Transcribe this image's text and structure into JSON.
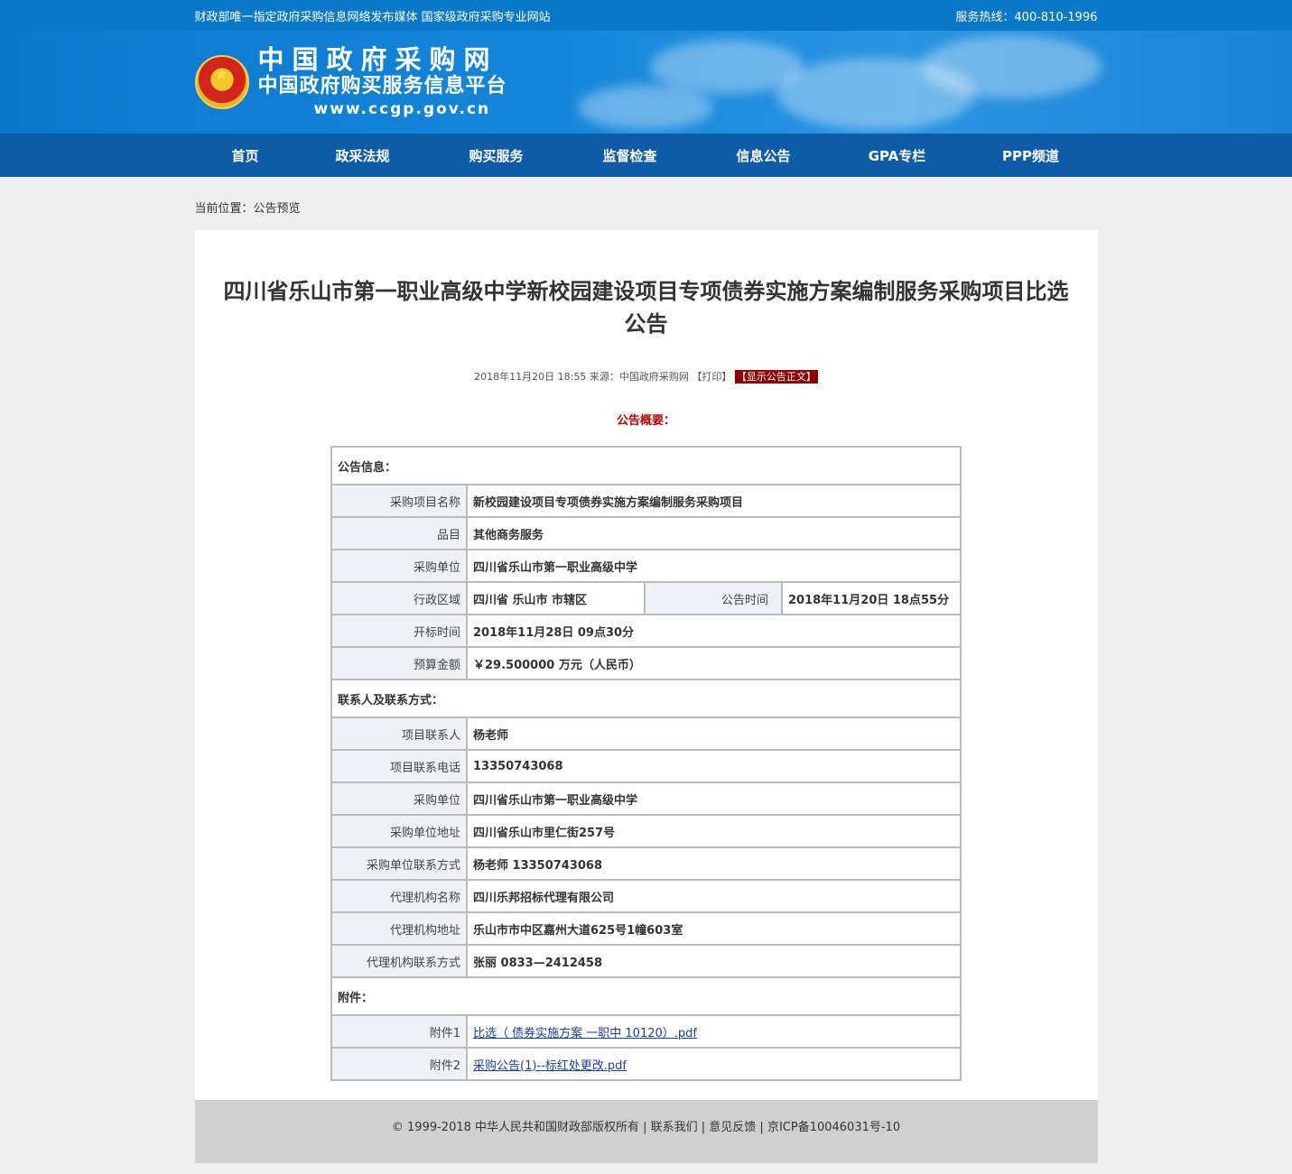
{
  "topbar": {
    "left": "财政部唯一指定政府采购信息网络发布媒体  国家级政府采购专业网站",
    "right": "服务热线：400-810-1996"
  },
  "logo": {
    "line1": "中国政府采购网",
    "line2": "中国政府购买服务信息平台",
    "line3": "www.ccgp.gov.cn"
  },
  "nav": [
    "首页",
    "政采法规",
    "购买服务",
    "监督检查",
    "信息公告",
    "GPA专栏",
    "PPP频道"
  ],
  "breadcrumb": "当前位置：公告预览",
  "article": {
    "title": "四川省乐山市第一职业高级中学新校园建设项目专项债券实施方案编制服务采购项目比选公告",
    "meta_text": "2018年11月20日 18:55 来源：中国政府采购网 【打印】",
    "show_body": "【显示公告正文】",
    "summary_heading": "公告概要："
  },
  "info": {
    "section_announce": "公告信息：",
    "project_name_label": "采购项目名称",
    "project_name": "新校园建设项目专项债券实施方案编制服务采购项目",
    "category_label": "品目",
    "category": "其他商务服务",
    "buyer_label": "采购单位",
    "buyer": "四川省乐山市第一职业高级中学",
    "region_label": "行政区域",
    "region": "四川省  乐山市  市辖区",
    "announce_time_label": "公告时间",
    "announce_time": "2018年11月20日  18点55分",
    "bid_open_label": "开标时间",
    "bid_open": "2018年11月28日  09点30分",
    "budget_label": "预算金额",
    "budget": "￥29.500000 万元（人民币）",
    "section_contact": "联系人及联系方式：",
    "contact_person_label": "项目联系人",
    "contact_person": "杨老师",
    "contact_phone_label": "项目联系电话",
    "contact_phone": "13350743068",
    "buyer2_label": "采购单位",
    "buyer2": "四川省乐山市第一职业高级中学",
    "buyer_addr_label": "采购单位地址",
    "buyer_addr": "四川省乐山市里仁街257号",
    "buyer_contact_label": "采购单位联系方式",
    "buyer_contact": "杨老师  13350743068",
    "agency_label": "代理机构名称",
    "agency": "四川乐邦招标代理有限公司",
    "agency_addr_label": "代理机构地址",
    "agency_addr": "乐山市市中区嘉州大道625号1幢603室",
    "agency_contact_label": "代理机构联系方式",
    "agency_contact": "张丽  0833—2412458",
    "section_attach": "附件：",
    "attach1_label": "附件1",
    "attach1": "比选（ 债券实施方案 一职中 10120）.pdf",
    "attach2_label": "附件2",
    "attach2": "采购公告(1)--标红处更改.pdf"
  },
  "footer": "© 1999-2018  中华人民共和国财政部版权所有  |  联系我们  |  意见反馈  |  京ICP备10046031号-10"
}
